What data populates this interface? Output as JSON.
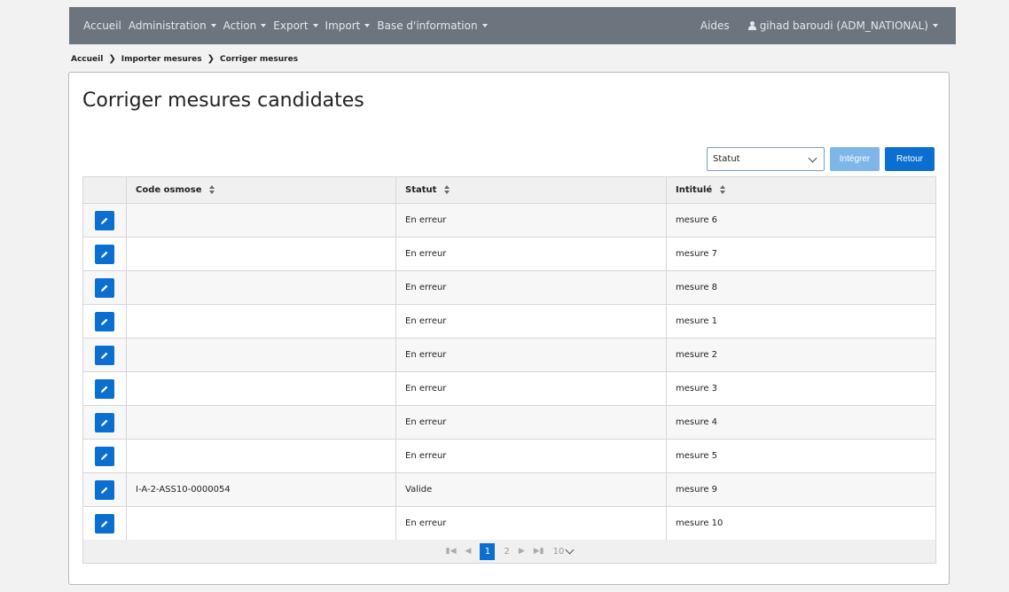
{
  "nav": {
    "items": [
      {
        "label": "Accueil",
        "caret": false
      },
      {
        "label": "Administration",
        "caret": true
      },
      {
        "label": "Action",
        "caret": true
      },
      {
        "label": "Export",
        "caret": true
      },
      {
        "label": "Import",
        "caret": true
      },
      {
        "label": "Base d'information",
        "caret": true
      }
    ],
    "aides": "Aides",
    "user": "gihad baroudi (ADM_NATIONAL)"
  },
  "breadcrumb": [
    "Accueil",
    "Importer mesures",
    "Corriger mesures"
  ],
  "page": {
    "title": "Corriger mesures candidates",
    "select_value": "Statut",
    "integrer_label": "Intégrer",
    "retour_label": "Retour"
  },
  "table": {
    "headers": [
      "Code osmose",
      "Statut",
      "Intitulé"
    ],
    "rows": [
      {
        "code": "",
        "statut": "En erreur",
        "intitule": "mesure 6"
      },
      {
        "code": "",
        "statut": "En erreur",
        "intitule": "mesure 7"
      },
      {
        "code": "",
        "statut": "En erreur",
        "intitule": "mesure 8"
      },
      {
        "code": "",
        "statut": "En erreur",
        "intitule": "mesure 1"
      },
      {
        "code": "",
        "statut": "En erreur",
        "intitule": "mesure 2"
      },
      {
        "code": "",
        "statut": "En erreur",
        "intitule": "mesure 3"
      },
      {
        "code": "",
        "statut": "En erreur",
        "intitule": "mesure 4"
      },
      {
        "code": "",
        "statut": "En erreur",
        "intitule": "mesure 5"
      },
      {
        "code": "I-A-2-ASS10-0000054",
        "statut": "Valide",
        "intitule": "mesure 9"
      },
      {
        "code": "",
        "statut": "En erreur",
        "intitule": "mesure 10"
      }
    ]
  },
  "pager": {
    "pages": [
      "1",
      "2"
    ],
    "current": "1",
    "page_size": "10"
  },
  "colors": {
    "navbar": "#6c757d",
    "primary": "#0b6fd1",
    "primary_disabled": "#7fb6ea"
  }
}
